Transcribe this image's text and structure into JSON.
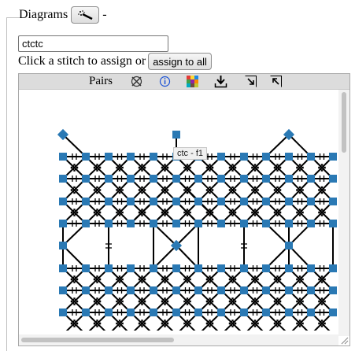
{
  "legend": {
    "title": "Diagrams",
    "suffix": "-",
    "wand_icon": "magic-wand-icon"
  },
  "pattern": {
    "value": "ctctc"
  },
  "assign": {
    "prompt": "Click a stitch to assign or",
    "button_label": "assign to all"
  },
  "toolbar": {
    "title": "Pairs",
    "icons": [
      "delete-icon",
      "info-icon",
      "color-palette-icon",
      "download-icon",
      "resize-down-icon",
      "resize-up-icon"
    ]
  },
  "tooltip": {
    "text": "ctc - f1"
  },
  "colors": {
    "node": "#2a79b4",
    "line": "#000000",
    "info": "#1a52d6"
  }
}
